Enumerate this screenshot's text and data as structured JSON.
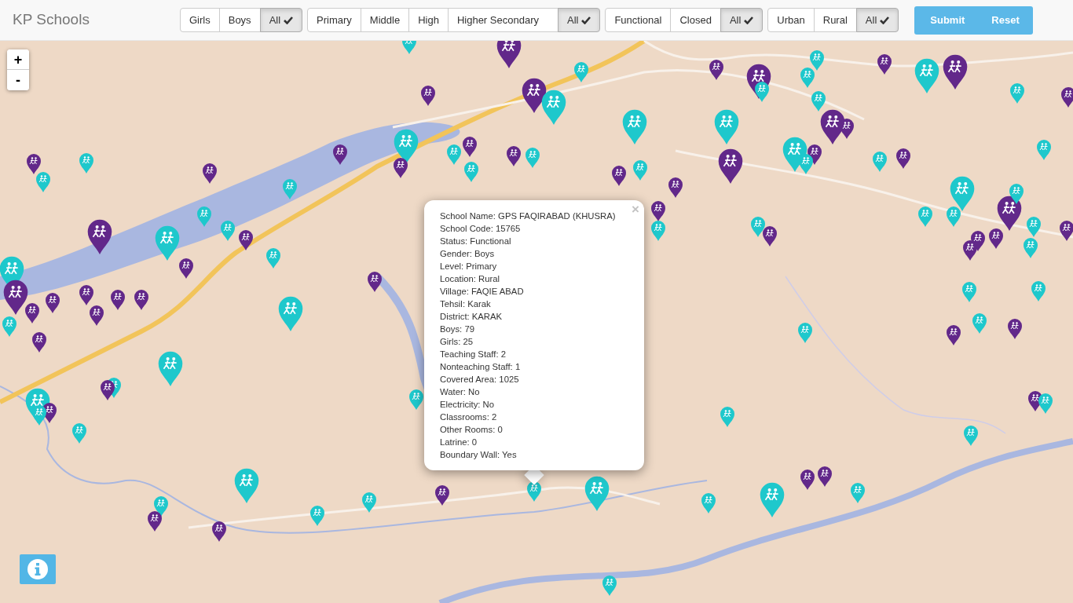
{
  "navbar": {
    "title": "KP Schools"
  },
  "filter_groups": [
    {
      "options": [
        {
          "label": "Girls",
          "selected": false
        },
        {
          "label": "Boys",
          "selected": false
        },
        {
          "label": "All",
          "selected": true
        }
      ]
    },
    {
      "options": [
        {
          "label": "Primary",
          "selected": false
        },
        {
          "label": "Middle",
          "selected": false
        },
        {
          "label": "High",
          "selected": false
        },
        {
          "label": "Higher Secondary",
          "selected": false
        },
        {
          "label": "All",
          "selected": true
        }
      ]
    },
    {
      "options": [
        {
          "label": "Functional",
          "selected": false
        },
        {
          "label": "Closed",
          "selected": false
        },
        {
          "label": "All",
          "selected": true
        }
      ]
    },
    {
      "options": [
        {
          "label": "Urban",
          "selected": false
        },
        {
          "label": "Rural",
          "selected": false
        },
        {
          "label": "All",
          "selected": true
        }
      ]
    }
  ],
  "actions": [
    "Submit",
    "Reset"
  ],
  "zoom_controls": [
    "+",
    "-"
  ],
  "popup": {
    "lines": [
      "School Name: GPS FAQIRABAD (KHUSRA)",
      "School Code: 15765",
      "Status: Functional",
      "Gender: Boys",
      "Level: Primary",
      "Location: Rural",
      "Village: FAQIE ABAD",
      "Tehsil: Karak",
      "District: KARAK",
      "Boys: 79",
      "Girls: 25",
      "Teaching Staff: 2",
      "Nonteaching Staff: 1",
      "Covered Area: 1025",
      "Water: No",
      "Electricity: No",
      "Classrooms: 2",
      "Other Rooms: 0",
      "Latrine: 0",
      "Boundary Wall: Yes"
    ],
    "close": "×"
  },
  "markers": [
    {
      "color": "#62288a",
      "large": true
    },
    {
      "color": "#62288a",
      "large": true
    },
    {
      "color": "#1ec8cc",
      "large": true
    },
    {
      "color": "#62288a",
      "large": false
    },
    {
      "color": "#1ec8cc",
      "large": true
    },
    {
      "color": "#62288a",
      "large": false
    },
    {
      "color": "#62288a",
      "large": false
    },
    {
      "color": "#62288a",
      "large": false
    },
    {
      "color": "#1ec8cc",
      "large": false
    },
    {
      "color": "#1ec8cc",
      "large": false
    },
    {
      "color": "#62288a",
      "large": false
    },
    {
      "color": "#1ec8cc",
      "large": false
    },
    {
      "color": "#1ec8cc",
      "large": true
    },
    {
      "color": "#1ec8cc",
      "large": false
    },
    {
      "color": "#62288a",
      "large": false
    },
    {
      "color": "#1ec8cc",
      "large": false
    },
    {
      "color": "#62288a",
      "large": false
    },
    {
      "color": "#62288a",
      "large": false
    },
    {
      "color": "#1ec8cc",
      "large": false
    },
    {
      "color": "#1ec8cc",
      "large": true
    },
    {
      "color": "#62288a",
      "large": false
    },
    {
      "color": "#62288a",
      "large": true
    },
    {
      "color": "#1ec8cc",
      "large": false
    },
    {
      "color": "#62288a",
      "large": true
    },
    {
      "color": "#1ec8cc",
      "large": true
    },
    {
      "color": "#62288a",
      "large": false
    },
    {
      "color": "#62288a",
      "large": true
    },
    {
      "color": "#62288a",
      "large": false
    },
    {
      "color": "#1ec8cc",
      "large": false
    },
    {
      "color": "#62288a",
      "large": false
    },
    {
      "color": "#1ec8cc",
      "large": true
    },
    {
      "color": "#62288a",
      "large": true
    },
    {
      "color": "#62288a",
      "large": false
    },
    {
      "color": "#1ec8cc",
      "large": false
    },
    {
      "color": "#1ec8cc",
      "large": false
    },
    {
      "color": "#1ec8cc",
      "large": false
    },
    {
      "color": "#1ec8cc",
      "large": false
    },
    {
      "color": "#62288a",
      "large": false
    },
    {
      "color": "#1ec8cc",
      "large": false
    },
    {
      "color": "#1ec8cc",
      "large": true
    },
    {
      "color": "#62288a",
      "large": true
    },
    {
      "color": "#1ec8cc",
      "large": false
    },
    {
      "color": "#1ec8cc",
      "large": false
    },
    {
      "color": "#1ec8cc",
      "large": false
    },
    {
      "color": "#62288a",
      "large": false
    },
    {
      "color": "#62288a",
      "large": false
    },
    {
      "color": "#62288a",
      "large": false
    },
    {
      "color": "#1ec8cc",
      "large": false
    },
    {
      "color": "#1ec8cc",
      "large": false
    },
    {
      "color": "#62288a",
      "large": false
    },
    {
      "color": "#1ec8cc",
      "large": false
    },
    {
      "color": "#1ec8cc",
      "large": false
    },
    {
      "color": "#1ec8cc",
      "large": false
    },
    {
      "color": "#62288a",
      "large": false
    },
    {
      "color": "#62288a",
      "large": false
    },
    {
      "color": "#1ec8cc",
      "large": false
    },
    {
      "color": "#1ec8cc",
      "large": false
    },
    {
      "color": "#62288a",
      "large": false
    },
    {
      "color": "#62288a",
      "large": false
    },
    {
      "color": "#1ec8cc",
      "large": false
    },
    {
      "color": "#1ec8cc",
      "large": false
    },
    {
      "color": "#1ec8cc",
      "large": false
    },
    {
      "color": "#1ec8cc",
      "large": true
    },
    {
      "color": "#62288a",
      "large": false
    },
    {
      "color": "#62288a",
      "large": false
    },
    {
      "color": "#1ec8cc",
      "large": false
    },
    {
      "color": "#1ec8cc",
      "large": false
    },
    {
      "color": "#1ec8cc",
      "large": true
    },
    {
      "color": "#1ec8cc",
      "large": false
    },
    {
      "color": "#62288a",
      "large": false
    },
    {
      "color": "#1ec8cc",
      "large": false
    },
    {
      "color": "#1ec8cc",
      "large": false
    },
    {
      "color": "#1ec8cc",
      "large": true
    },
    {
      "color": "#62288a",
      "large": false
    },
    {
      "color": "#1ec8cc",
      "large": false
    },
    {
      "color": "#62288a",
      "large": false
    },
    {
      "color": "#1ec8cc",
      "large": false
    },
    {
      "color": "#1ec8cc",
      "large": true
    },
    {
      "color": "#62288a",
      "large": false
    },
    {
      "color": "#1ec8cc",
      "large": false
    },
    {
      "color": "#1ec8cc",
      "large": false
    },
    {
      "color": "#62288a",
      "large": false
    },
    {
      "color": "#1ec8cc",
      "large": true
    },
    {
      "color": "#1ec8cc",
      "large": false
    },
    {
      "color": "#1ec8cc",
      "large": true
    },
    {
      "color": "#62288a",
      "large": false
    },
    {
      "color": "#1ec8cc",
      "large": false
    },
    {
      "color": "#62288a",
      "large": false
    },
    {
      "color": "#1ec8cc",
      "large": false
    },
    {
      "color": "#1ec8cc",
      "large": false
    },
    {
      "color": "#1ec8cc",
      "large": true
    },
    {
      "color": "#62288a",
      "large": false
    },
    {
      "color": "#62288a",
      "large": true
    },
    {
      "color": "#1ec8cc",
      "large": true
    },
    {
      "color": "#62288a",
      "large": true
    },
    {
      "color": "#62288a",
      "large": false
    },
    {
      "color": "#62288a",
      "large": false
    },
    {
      "color": "#62288a",
      "large": false
    },
    {
      "color": "#62288a",
      "large": false
    },
    {
      "color": "#62288a",
      "large": false
    },
    {
      "color": "#62288a",
      "large": false
    },
    {
      "color": "#1ec8cc",
      "large": false
    },
    {
      "color": "#62288a",
      "large": false
    },
    {
      "color": "#62288a",
      "large": false
    },
    {
      "color": "#1ec8cc",
      "large": false
    },
    {
      "color": "#1ec8cc",
      "large": false
    },
    {
      "color": "#62288a",
      "large": false
    },
    {
      "color": "#1ec8cc",
      "large": false
    },
    {
      "color": "#1ec8cc",
      "large": false
    },
    {
      "color": "#1ec8cc",
      "large": false
    },
    {
      "color": "#1ec8cc",
      "large": false
    }
  ]
}
